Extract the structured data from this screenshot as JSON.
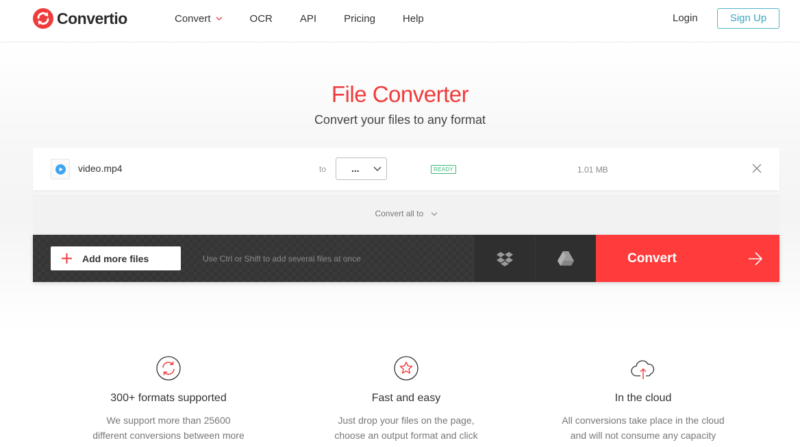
{
  "header": {
    "brand": "Convertio",
    "nav": [
      {
        "label": "Convert",
        "has_dropdown": true
      },
      {
        "label": "OCR"
      },
      {
        "label": "API"
      },
      {
        "label": "Pricing"
      },
      {
        "label": "Help"
      }
    ],
    "login": "Login",
    "signup": "Sign Up"
  },
  "hero": {
    "title": "File Converter",
    "subtitle": "Convert your files to any format"
  },
  "file": {
    "name": "video.mp4",
    "to_label": "to",
    "format_value": "...",
    "status": "READY",
    "size": "1.01 MB"
  },
  "convert_all": "Convert all to",
  "actions": {
    "add_files": "Add more files",
    "hint": "Use Ctrl or Shift to add several files at once",
    "convert": "Convert"
  },
  "features": [
    {
      "icon": "refresh-icon",
      "title": "300+ formats supported",
      "desc_lines": [
        "We support more than 25600",
        "different conversions between more"
      ]
    },
    {
      "icon": "star-icon",
      "title": "Fast and easy",
      "desc_lines": [
        "Just drop your files on the page,",
        "choose an output format and click"
      ]
    },
    {
      "icon": "cloud-upload-icon",
      "title": "In the cloud",
      "desc_lines": [
        "All conversions take place in the cloud",
        "and will not consume any capacity"
      ]
    }
  ],
  "colors": {
    "brand_red": "#ef3b3b",
    "convert_button": "#ff3b3b",
    "signup_accent": "#38a6c0",
    "ready_green": "#3cb878"
  }
}
